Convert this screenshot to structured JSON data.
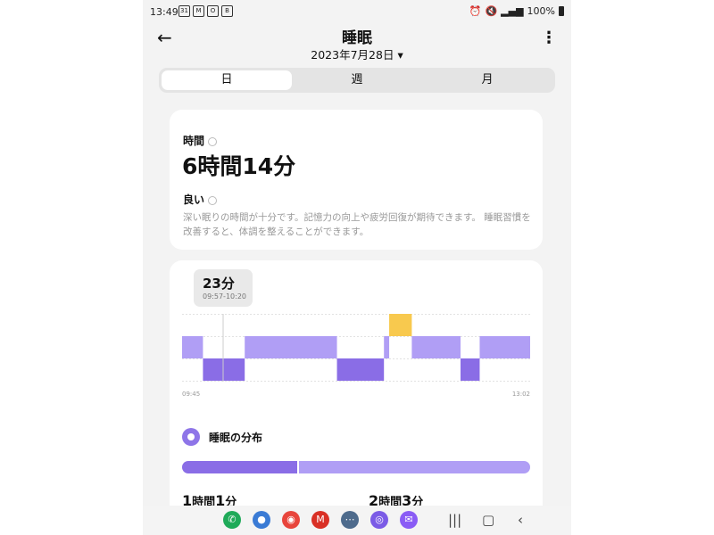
{
  "status_bar": {
    "time": "13:49",
    "left_icons": [
      "31",
      "M",
      "O",
      "B"
    ],
    "right_text": "100%"
  },
  "header": {
    "title": "睡眠",
    "date": "2023年7月28日",
    "date_caret": "▾",
    "back_glyph": "←",
    "more_glyph": "⋮"
  },
  "tabs": [
    {
      "label": "日",
      "active": true
    },
    {
      "label": "週",
      "active": false
    },
    {
      "label": "月",
      "active": false
    }
  ],
  "summary": {
    "time_label": "時間",
    "duration": "6時間14分",
    "quality_label": "良い",
    "description": "深い眠りの時間が十分です。記憶力の向上や疲労回復が期待できます。 睡眠習慣を改善すると、体調を整えることができます。"
  },
  "chart_data": {
    "type": "sleep-stages",
    "tooltip": {
      "value": "23分",
      "range": "09:57-10:20"
    },
    "x_start": "09:45",
    "x_end": "13:02",
    "stages": [
      "awake",
      "light",
      "deep"
    ],
    "segments": [
      {
        "stage": "light",
        "start": 0.0,
        "end": 0.06
      },
      {
        "stage": "deep",
        "start": 0.06,
        "end": 0.18
      },
      {
        "stage": "light",
        "start": 0.18,
        "end": 0.445
      },
      {
        "stage": "deep",
        "start": 0.445,
        "end": 0.58
      },
      {
        "stage": "light",
        "start": 0.58,
        "end": 0.595
      },
      {
        "stage": "awake",
        "start": 0.595,
        "end": 0.66
      },
      {
        "stage": "light",
        "start": 0.66,
        "end": 0.8
      },
      {
        "stage": "deep",
        "start": 0.8,
        "end": 0.855
      },
      {
        "stage": "light",
        "start": 0.855,
        "end": 1.0
      }
    ],
    "colors": {
      "awake": "#f8c94e",
      "light": "#b09ef5",
      "deep": "#8a6de6"
    }
  },
  "distribution": {
    "title": "睡眠の分布",
    "deep_fraction": 0.33,
    "stats": [
      {
        "h": "1",
        "h_unit": "時間",
        "m": "1",
        "m_unit": "分"
      },
      {
        "h": "2",
        "h_unit": "時間",
        "m": "3",
        "m_unit": "分"
      }
    ]
  },
  "navbar": {
    "apps": [
      {
        "name": "phone",
        "glyph": "✆",
        "color": "#1faa59"
      },
      {
        "name": "messages",
        "glyph": "●",
        "color": "#3a7bd5"
      },
      {
        "name": "chrome",
        "glyph": "◉",
        "color": "#e8453c"
      },
      {
        "name": "gmail",
        "glyph": "M",
        "color": "#d93025"
      },
      {
        "name": "apps",
        "glyph": "⋯",
        "color": "#4e6b8c"
      },
      {
        "name": "camera",
        "glyph": "◎",
        "color": "#7b5be6"
      },
      {
        "name": "messenger",
        "glyph": "✉",
        "color": "#8a5cf5"
      }
    ],
    "recent": "|||",
    "home": "▢",
    "back": "‹"
  }
}
